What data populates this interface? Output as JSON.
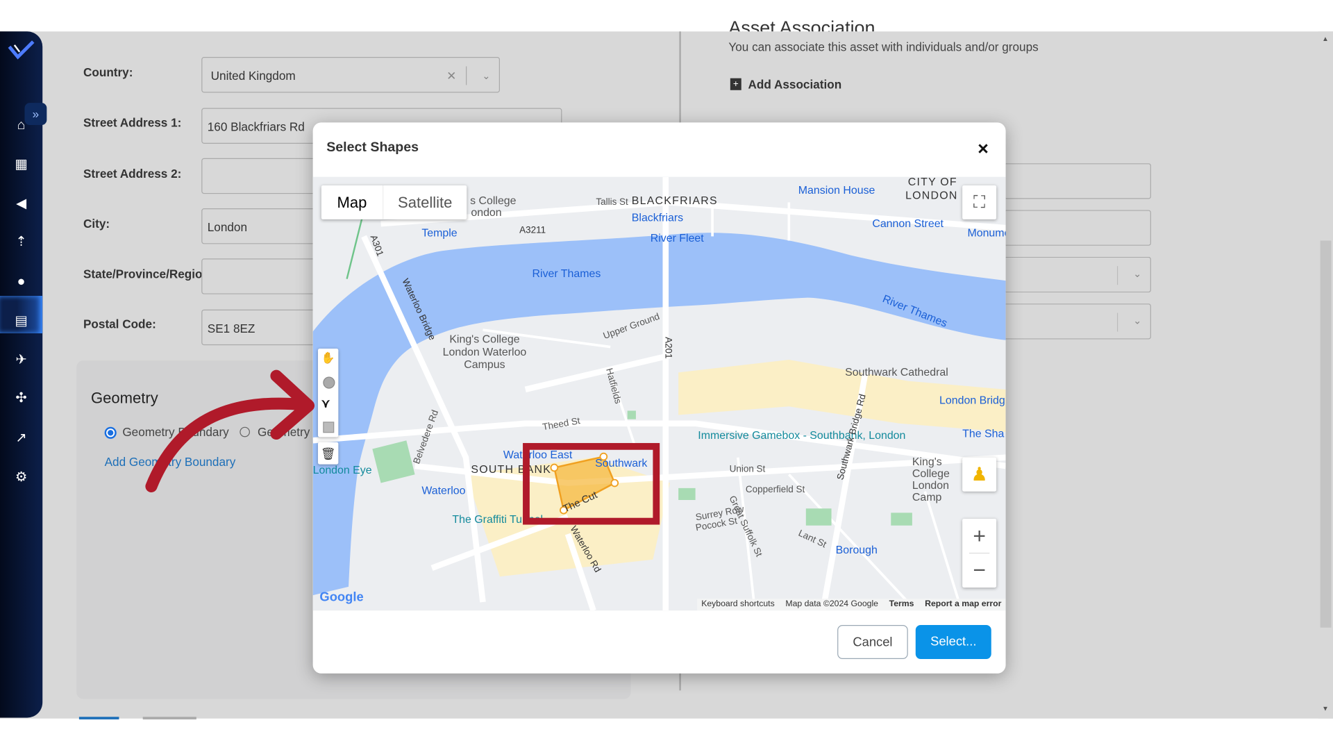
{
  "sidebar": {
    "items": [
      {
        "icon": "home-icon"
      },
      {
        "icon": "map-icon"
      },
      {
        "icon": "megaphone-icon"
      },
      {
        "icon": "route-icon"
      },
      {
        "icon": "location-pin-icon",
        "active": true
      },
      {
        "icon": "bar-chart-icon"
      },
      {
        "icon": "airplane-icon"
      },
      {
        "icon": "drone-icon"
      },
      {
        "icon": "line-chart-icon"
      },
      {
        "icon": "settings-icon"
      }
    ]
  },
  "form": {
    "country_label": "Country:",
    "country_value": "United Kingdom",
    "street1_label": "Street Address 1:",
    "street1_value": "160 Blackfriars Rd",
    "street2_label": "Street Address 2:",
    "street2_value": "",
    "city_label": "City:",
    "city_value": "London",
    "state_label": "State/Province/Regio",
    "state_value": "",
    "postal_label": "Postal Code:",
    "postal_value": "SE1 8EZ"
  },
  "geometry": {
    "title": "Geometry",
    "option1": "Geometry Boundary",
    "option2": "Geometry",
    "option1_selected": true,
    "add_link": "Add Geometry Boundary"
  },
  "association": {
    "title": "Asset Association",
    "subtitle": "You can associate this asset with individuals and/or groups",
    "add_label": "Add Association"
  },
  "modal": {
    "title": "Select Shapes",
    "close": "×",
    "map_type_tabs": [
      "Map",
      "Satellite"
    ],
    "active_map_type": "Map",
    "map_labels": [
      "BLACKFRIARS",
      "Blackfriars",
      "Tallis St",
      "Mansion House",
      "CITY OF",
      "LONDON",
      "Cannon Street",
      "Monume",
      "River Fleet",
      "River Thames",
      "River Thames",
      "King's College London Waterloo Campus",
      "Temple",
      "A3211",
      "A301",
      "Waterloo Bridge",
      "Upper Ground",
      "A201",
      "Southwark Cathedral",
      "London Bridg",
      "Immersive Gamebox - Southbank, London",
      "SOUTH BANK",
      "Waterloo East",
      "Southwark",
      "Waterloo",
      "Theed St",
      "Union St",
      "Copperfield St",
      "The Cut",
      "The Graffiti Tunnel",
      "Waterloo Rd",
      "Southwark Bridge Rd",
      "King's College London Camp",
      "Borough",
      "Surrey Row",
      "Pocock St",
      "Great Suffolk St",
      "Lant St",
      "The Sha",
      "London Eye",
      "Belvedere Rd",
      "Hatfields",
      "s College",
      "ondon"
    ],
    "attribution": {
      "keyboard": "Keyboard shortcuts",
      "data": "Map data ©2024 Google",
      "terms": "Terms",
      "report": "Report a map error",
      "logo": "Google"
    },
    "drawing_tools": [
      "hand-icon",
      "circle-icon",
      "polygon-icon",
      "rectangle-icon",
      "trash-icon"
    ],
    "active_tool": "polygon-icon",
    "cancel": "Cancel",
    "select": "Select..."
  },
  "colors": {
    "primary": "#0a93e8",
    "annotation": "#b01a2a",
    "shape_fill": "#f5b942",
    "water": "#9cc0f9"
  }
}
